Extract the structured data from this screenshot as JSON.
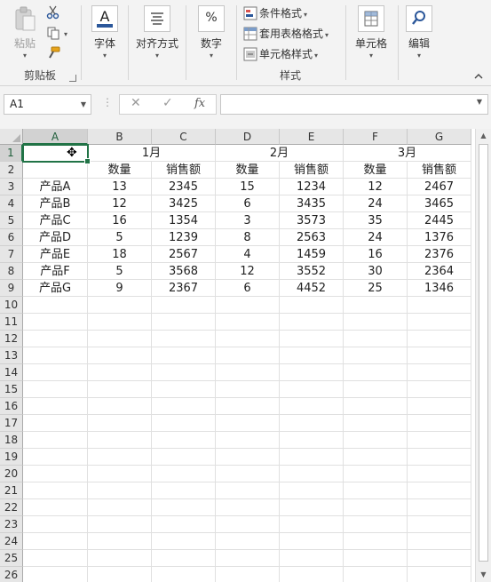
{
  "ribbon": {
    "clipboard": {
      "paste_label": "粘贴",
      "group_label": "剪贴板"
    },
    "font": {
      "label": "字体",
      "icon_letter": "A"
    },
    "alignment": {
      "label": "对齐方式"
    },
    "number": {
      "label": "数字",
      "icon_symbol": "%"
    },
    "styles": {
      "conditional_format": "条件格式",
      "format_as_table": "套用表格格式",
      "cell_styles": "单元格样式",
      "group_label": "样式"
    },
    "cells": {
      "label": "单元格"
    },
    "editing": {
      "label": "编辑"
    },
    "collapse_symbol": "^"
  },
  "formula_bar": {
    "name_box": "A1",
    "cancel_symbol": "✕",
    "enter_symbol": "✓",
    "fx_symbol": "fx",
    "formula": ""
  },
  "sheet": {
    "columns": [
      "A",
      "B",
      "C",
      "D",
      "E",
      "F",
      "G"
    ],
    "rows": [
      "1",
      "2",
      "3",
      "4",
      "5",
      "6",
      "7",
      "8",
      "9",
      "10",
      "11",
      "12",
      "13",
      "14",
      "15",
      "16",
      "17",
      "18",
      "19",
      "20",
      "21",
      "22",
      "23",
      "24",
      "25",
      "26"
    ],
    "selected_cell": "A1",
    "month_headers": [
      "1月",
      "2月",
      "3月"
    ],
    "sub_headers": [
      "数量",
      "销售额",
      "数量",
      "销售额",
      "数量",
      "销售额"
    ],
    "products": [
      {
        "name": "产品A",
        "values": [
          "13",
          "2345",
          "15",
          "1234",
          "12",
          "2467"
        ]
      },
      {
        "name": "产品B",
        "values": [
          "12",
          "3425",
          "6",
          "3435",
          "24",
          "3465"
        ]
      },
      {
        "name": "产品C",
        "values": [
          "16",
          "1354",
          "3",
          "3573",
          "35",
          "2445"
        ]
      },
      {
        "name": "产品D",
        "values": [
          "5",
          "1239",
          "8",
          "2563",
          "24",
          "1376"
        ]
      },
      {
        "name": "产品E",
        "values": [
          "18",
          "2567",
          "4",
          "1459",
          "16",
          "2376"
        ]
      },
      {
        "name": "产品F",
        "values": [
          "5",
          "3568",
          "12",
          "3552",
          "30",
          "2364"
        ]
      },
      {
        "name": "产品G",
        "values": [
          "9",
          "2367",
          "6",
          "4452",
          "25",
          "1346"
        ]
      }
    ]
  },
  "colors": {
    "accent": "#217346",
    "header_bg": "#e6e6e6",
    "ribbon_bg": "#f3f3f3"
  }
}
